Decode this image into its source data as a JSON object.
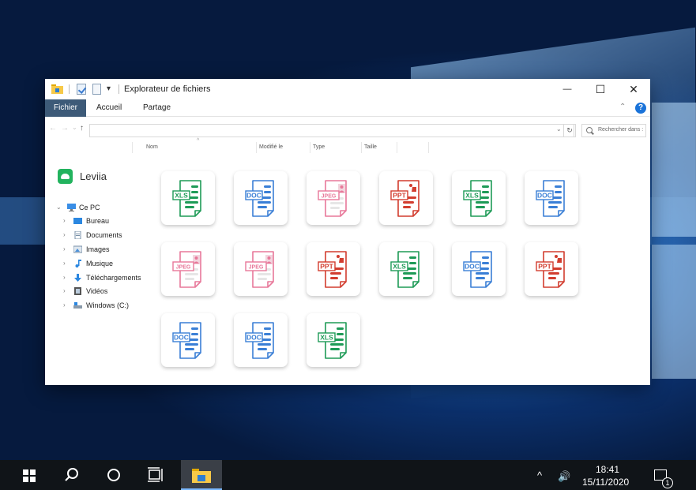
{
  "window": {
    "title": "Explorateur de fichiers",
    "qa_dropdown": "▾",
    "controls": {
      "minimize": "—",
      "maximize": "☐",
      "close": "✕"
    }
  },
  "ribbon": {
    "tabs": [
      {
        "label": "Fichier",
        "selected": true
      },
      {
        "label": "Accueil",
        "selected": false
      },
      {
        "label": "Partage",
        "selected": false
      }
    ],
    "collapse": "⌃",
    "help": "?"
  },
  "address": {
    "back": "←",
    "forward": "→",
    "recent": "⌄",
    "up": "↑",
    "value": "",
    "dropdown": "⌄",
    "refresh": "↻",
    "search_placeholder": "Rechercher dans :"
  },
  "columns": [
    "Nom",
    "Modifié le",
    "Type",
    "Taille"
  ],
  "sort_indicator": "^",
  "brand": {
    "name": "Leviia",
    "color": "#22b35e"
  },
  "tree": {
    "root": {
      "label": "Ce PC",
      "icon": "computer-icon"
    },
    "items": [
      {
        "label": "Bureau",
        "icon": "desktop-icon"
      },
      {
        "label": "Documents",
        "icon": "documents-icon"
      },
      {
        "label": "Images",
        "icon": "pictures-icon"
      },
      {
        "label": "Musique",
        "icon": "music-icon"
      },
      {
        "label": "Téléchargements",
        "icon": "downloads-icon"
      },
      {
        "label": "Vidéos",
        "icon": "videos-icon"
      },
      {
        "label": "Windows (C:)",
        "icon": "drive-icon"
      }
    ],
    "chevron_open": "⌄",
    "chevron_closed": "›"
  },
  "files": [
    {
      "type": "XLS"
    },
    {
      "type": "DOC"
    },
    {
      "type": "JPEG"
    },
    {
      "type": "PPT"
    },
    {
      "type": "XLS"
    },
    {
      "type": "DOC"
    },
    {
      "type": "JPEG"
    },
    {
      "type": "JPEG"
    },
    {
      "type": "PPT"
    },
    {
      "type": "XLS"
    },
    {
      "type": "DOC"
    },
    {
      "type": "PPT"
    },
    {
      "type": "DOC"
    },
    {
      "type": "DOC"
    },
    {
      "type": "XLS"
    }
  ],
  "file_colors": {
    "XLS": "#1e9b57",
    "DOC": "#3a7fd6",
    "JPEG": "#e8789a",
    "PPT": "#d23d2f"
  },
  "taskbar": {
    "time": "18:41",
    "date": "15/11/2020",
    "notification_count": "1",
    "tray_arrow": "^",
    "volume": "🔊"
  }
}
